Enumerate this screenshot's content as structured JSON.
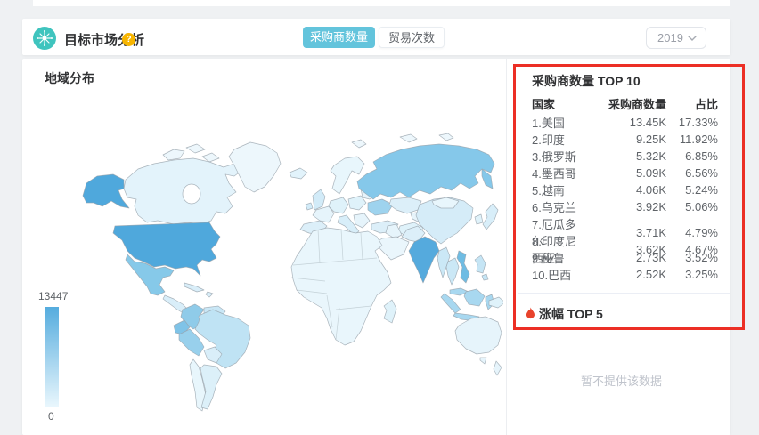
{
  "header": {
    "title": "目标市场分析",
    "help_glyph": "?",
    "tabs": [
      {
        "label": "采购商数量",
        "active": true
      },
      {
        "label": "贸易次数",
        "active": false
      }
    ],
    "year_select": {
      "value": "2019"
    }
  },
  "map_section": {
    "title": "地域分布",
    "legend": {
      "max": "13447",
      "min": "0"
    }
  },
  "top10": {
    "title": "采购商数量 TOP 10",
    "columns": [
      "国家",
      "采购商数量",
      "占比"
    ]
  },
  "growth_section": {
    "title": "涨幅 TOP 5",
    "empty_text": "暂不提供该数据"
  },
  "colors": {
    "accent_teal": "#63C4DC",
    "brand_icon_teal": "#3FC4BE",
    "help_orange": "#F7B500",
    "annotation_red": "#EC2F25",
    "flame_red": "#E8432C",
    "map_scale_high": "#4FA8DC",
    "map_scale_low": "#EAF7FD"
  },
  "chart_data": {
    "type": "heatmap",
    "subtype": "world-choropleth",
    "title": "地域分布",
    "metric": "采购商数量",
    "year": "2019",
    "color_domain": [
      0,
      13447
    ],
    "colormap": [
      "#EAF7FD",
      "#4FA8DC"
    ],
    "legend_position": "bottom-left",
    "rows": [
      {
        "rank": 1,
        "country": "美国",
        "label": "1.美国",
        "count": "13.45K",
        "count_value": 13450,
        "share": "17.33%"
      },
      {
        "rank": 2,
        "country": "印度",
        "label": "2.印度",
        "count": "9.25K",
        "count_value": 9250,
        "share": "11.92%"
      },
      {
        "rank": 3,
        "country": "俄罗斯",
        "label": "3.俄罗斯",
        "count": "5.32K",
        "count_value": 5320,
        "share": "6.85%"
      },
      {
        "rank": 4,
        "country": "墨西哥",
        "label": "4.墨西哥",
        "count": "5.09K",
        "count_value": 5090,
        "share": "6.56%"
      },
      {
        "rank": 5,
        "country": "越南",
        "label": "5.越南",
        "count": "4.06K",
        "count_value": 4060,
        "share": "5.24%"
      },
      {
        "rank": 6,
        "country": "乌克兰",
        "label": "6.乌克兰",
        "count": "3.92K",
        "count_value": 3920,
        "share": "5.06%"
      },
      {
        "rank": 7,
        "country": "厄瓜多尔",
        "label": "7.厄瓜多尔",
        "count": "3.71K",
        "count_value": 3710,
        "share": "4.79%"
      },
      {
        "rank": 8,
        "country": "印度尼西亚",
        "label": "8.印度尼西亚",
        "count": "3.62K",
        "count_value": 3620,
        "share": "4.67%"
      },
      {
        "rank": 9,
        "country": "秘鲁",
        "label": "9.秘鲁",
        "count": "2.73K",
        "count_value": 2730,
        "share": "3.52%"
      },
      {
        "rank": 10,
        "country": "巴西",
        "label": "10.巴西",
        "count": "2.52K",
        "count_value": 2520,
        "share": "3.25%"
      }
    ]
  }
}
